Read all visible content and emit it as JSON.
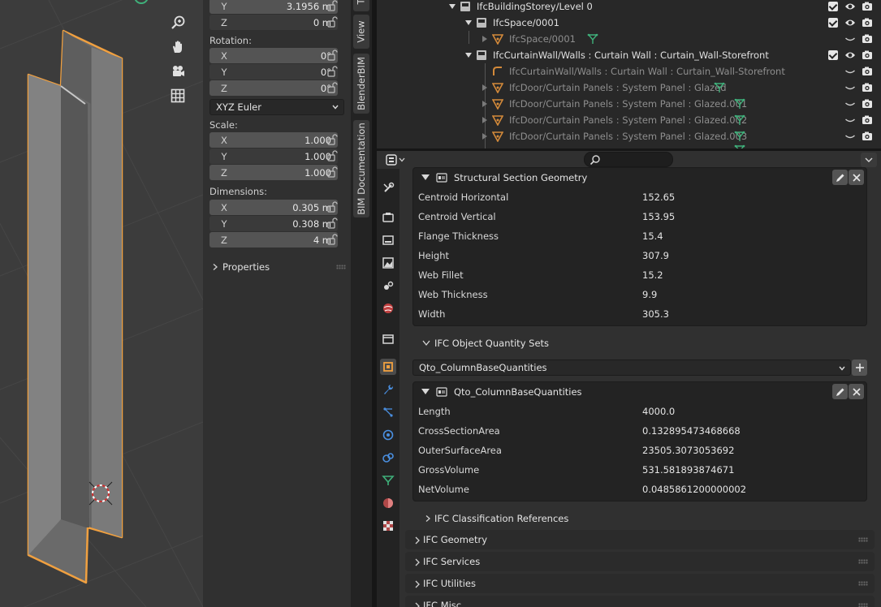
{
  "npanel": {
    "location_y": "3.1956 m",
    "location_z": "0 m",
    "rotation_label": "Rotation:",
    "rotation": [
      {
        "axis": "X",
        "value": "0°"
      },
      {
        "axis": "Y",
        "value": "0°"
      },
      {
        "axis": "Z",
        "value": "0°"
      }
    ],
    "rotation_mode": "XYZ Euler",
    "scale_label": "Scale:",
    "scale": [
      {
        "axis": "X",
        "value": "1.000"
      },
      {
        "axis": "Y",
        "value": "1.000"
      },
      {
        "axis": "Z",
        "value": "1.000"
      }
    ],
    "dimensions_label": "Dimensions:",
    "dimensions": [
      {
        "axis": "X",
        "value": "0.305 m"
      },
      {
        "axis": "Y",
        "value": "0.308 m"
      },
      {
        "axis": "Z",
        "value": "4 m"
      }
    ],
    "properties_label": "Properties",
    "axis_y": "Y",
    "axis_z": "Z"
  },
  "vtabs": {
    "top": "T",
    "view": "View",
    "blenderbim": "BlenderBIM",
    "bim_docs": "BIM Documentation"
  },
  "outliner": {
    "rows": [
      {
        "label": "IfcBuildingStorey/Level 0"
      },
      {
        "label": "IfcSpace/0001"
      },
      {
        "label": "IfcSpace/0001"
      },
      {
        "label": "IfcCurtainWall/Walls : Curtain Wall : Curtain_Wall-Storefront"
      },
      {
        "label": "IfcCurtainWall/Walls : Curtain Wall : Curtain_Wall-Storefront"
      },
      {
        "label": "IfcDoor/Curtain Panels : System Panel : Glazed"
      },
      {
        "label": "IfcDoor/Curtain Panels : System Panel : Glazed.001"
      },
      {
        "label": "IfcDoor/Curtain Panels : System Panel : Glazed.002"
      },
      {
        "label": "IfcDoor/Curtain Panels : System Panel : Glazed.003"
      }
    ]
  },
  "props": {
    "section_geometry": {
      "title": "Structural Section Geometry",
      "rows": [
        {
          "key": "Centroid Horizontal",
          "value": "152.65"
        },
        {
          "key": "Centroid Vertical",
          "value": "153.95"
        },
        {
          "key": "Flange Thickness",
          "value": "15.4"
        },
        {
          "key": "Height",
          "value": "307.9"
        },
        {
          "key": "Web Fillet",
          "value": "15.2"
        },
        {
          "key": "Web Thickness",
          "value": "9.9"
        },
        {
          "key": "Width",
          "value": "305.3"
        }
      ]
    },
    "qto_sets_title": "IFC Object Quantity Sets",
    "qto_selected": "Qto_ColumnBaseQuantities",
    "qto": {
      "title": "Qto_ColumnBaseQuantities",
      "rows": [
        {
          "key": "Length",
          "value": "4000.0"
        },
        {
          "key": "CrossSectionArea",
          "value": "0.132895473468668"
        },
        {
          "key": "OuterSurfaceArea",
          "value": "23505.3073053692"
        },
        {
          "key": "GrossVolume",
          "value": "531.581893874671"
        },
        {
          "key": "NetVolume",
          "value": "0.0485861200000002"
        }
      ]
    },
    "classification_title": "IFC Classification References",
    "panels": [
      "IFC Geometry",
      "IFC Services",
      "IFC Utilities",
      "IFC Misc"
    ]
  },
  "colors": {
    "selection_outline": "#f0a040",
    "accent_blue": "#4a8fe0",
    "mesh_green": "#3fb07a"
  }
}
